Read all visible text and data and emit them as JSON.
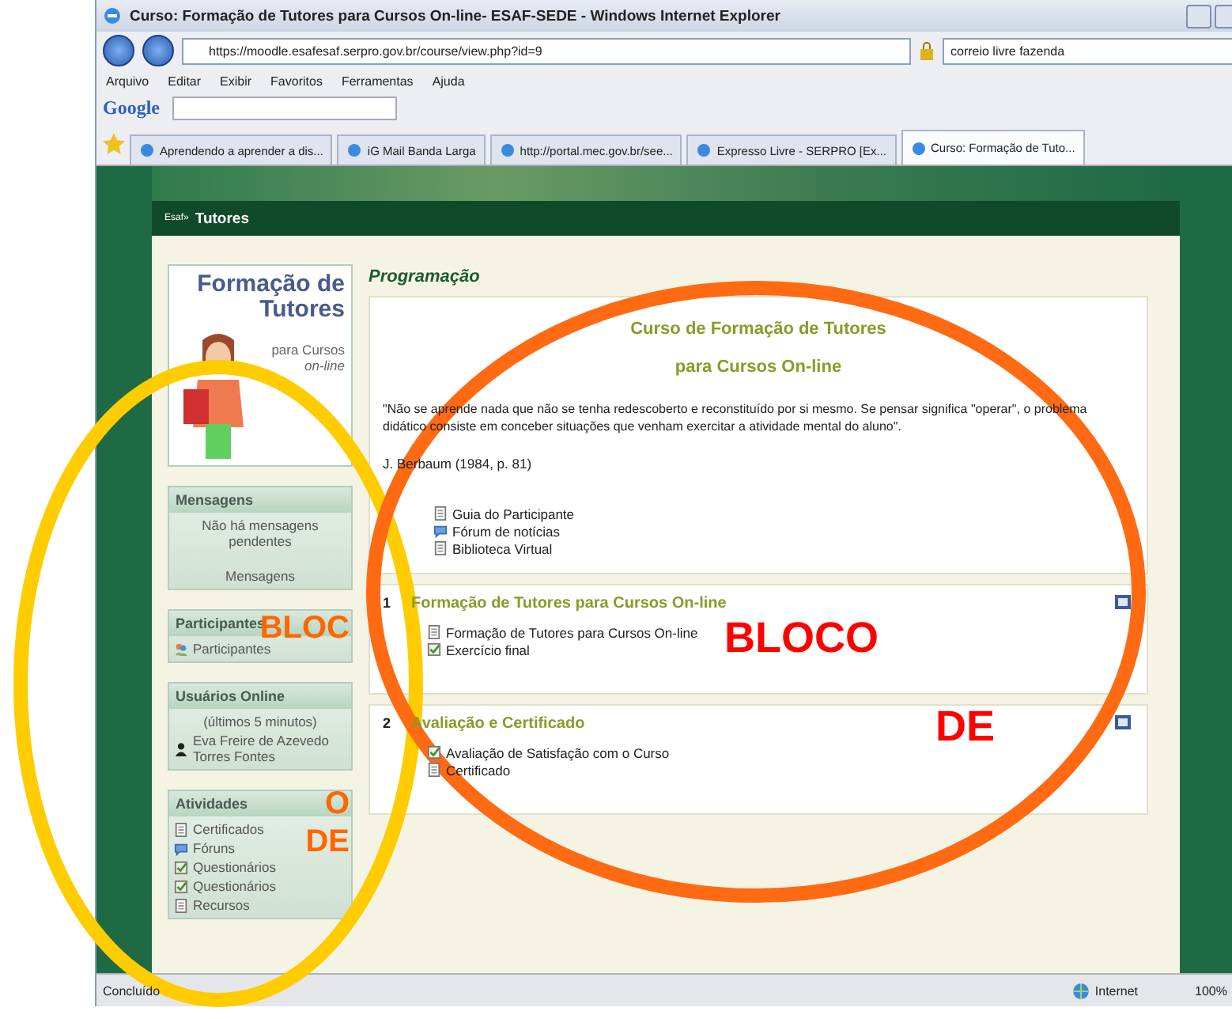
{
  "window": {
    "title": "Curso: Formação de Tutores para Cursos On-line- ESAF-SEDE - Windows Internet Explorer"
  },
  "address_bar": {
    "url": "https://moodle.esafesaf.serpro.gov.br/course/view.php?id=9"
  },
  "search": {
    "value": "correio livre fazenda"
  },
  "menu": [
    "Arquivo",
    "Editar",
    "Exibir",
    "Favoritos",
    "Ferramentas",
    "Ajuda"
  ],
  "google_toolbar": {
    "label": "Google"
  },
  "tabs": [
    {
      "label": "Aprendendo a aprender a dis...",
      "selected": false
    },
    {
      "label": "iG Mail Banda Larga",
      "selected": false
    },
    {
      "label": "http://portal.mec.gov.br/see...",
      "selected": false
    },
    {
      "label": "Expresso Livre - SERPRO [Ex...",
      "selected": false
    },
    {
      "label": "Curso: Formação de Tuto...",
      "selected": true
    }
  ],
  "page_header": {
    "site": "Esaf»",
    "title": "Tutores"
  },
  "sidebar": {
    "logo": {
      "title": "Formação de Tutores",
      "subtitle": "para Cursos",
      "subtitle_2": "on-line"
    },
    "blocks": [
      {
        "title": "Mensagens",
        "kind": "messages",
        "lines": [
          "Não há mensagens pendentes"
        ],
        "link": "Mensagens"
      },
      {
        "title": "Participantes",
        "kind": "list",
        "items": [
          {
            "label": "Participantes",
            "kind": "people"
          }
        ]
      },
      {
        "title": "Usuários Online",
        "kind": "online",
        "lines": [
          "(últimos 5 minutos)"
        ],
        "items": [
          {
            "label": "Eva Freire de Azevedo Torres Fontes",
            "kind": "user"
          }
        ]
      },
      {
        "title": "Atividades",
        "kind": "list",
        "items": [
          {
            "label": "Certificados",
            "kind": "doc"
          },
          {
            "label": "Fóruns",
            "kind": "forum"
          },
          {
            "label": "Questionários",
            "kind": "quiz"
          },
          {
            "label": "Questionários",
            "kind": "quiz"
          },
          {
            "label": "Recursos",
            "kind": "doc"
          }
        ]
      }
    ]
  },
  "main": {
    "heading": "Programação",
    "intro": {
      "title_lines": [
        "Curso de Formação de Tutores",
        "para Cursos On-line"
      ],
      "quote": "\"Não se aprende nada que não se tenha redescoberto e reconstituído por si mesmo. Se pensar significa \"operar\", o problema didático consiste em conceber situações que venham exercitar a atividade mental do aluno\".",
      "citation": "J. Berbaum (1984, p. 81)",
      "items": [
        {
          "label": "Guia do Participante",
          "kind": "doc"
        },
        {
          "label": "Fórum de notícias",
          "kind": "forum"
        },
        {
          "label": "Biblioteca Virtual",
          "kind": "doc"
        }
      ]
    },
    "sections": [
      {
        "number": "1",
        "title": "Formação de Tutores para Cursos On-line",
        "items": [
          {
            "label": "Formação de Tutores para Cursos On-line",
            "kind": "doc"
          },
          {
            "label": "Exercício final",
            "kind": "quiz"
          }
        ]
      },
      {
        "number": "2",
        "title": "Avaliação e Certificado",
        "items": [
          {
            "label": "Avaliação de Satisfação com o Curso",
            "kind": "quiz"
          },
          {
            "label": "Certificado",
            "kind": "doc"
          }
        ]
      }
    ]
  },
  "status_bar": {
    "text": "Concluído",
    "zone": "Internet",
    "zoom": "100%"
  },
  "annotations": [
    {
      "color": "#ffcc00",
      "labels": [
        "BLOC",
        "O",
        "DE"
      ]
    },
    {
      "color": "#ff6a13",
      "labels": [
        "BLOCO",
        "DE"
      ]
    }
  ]
}
